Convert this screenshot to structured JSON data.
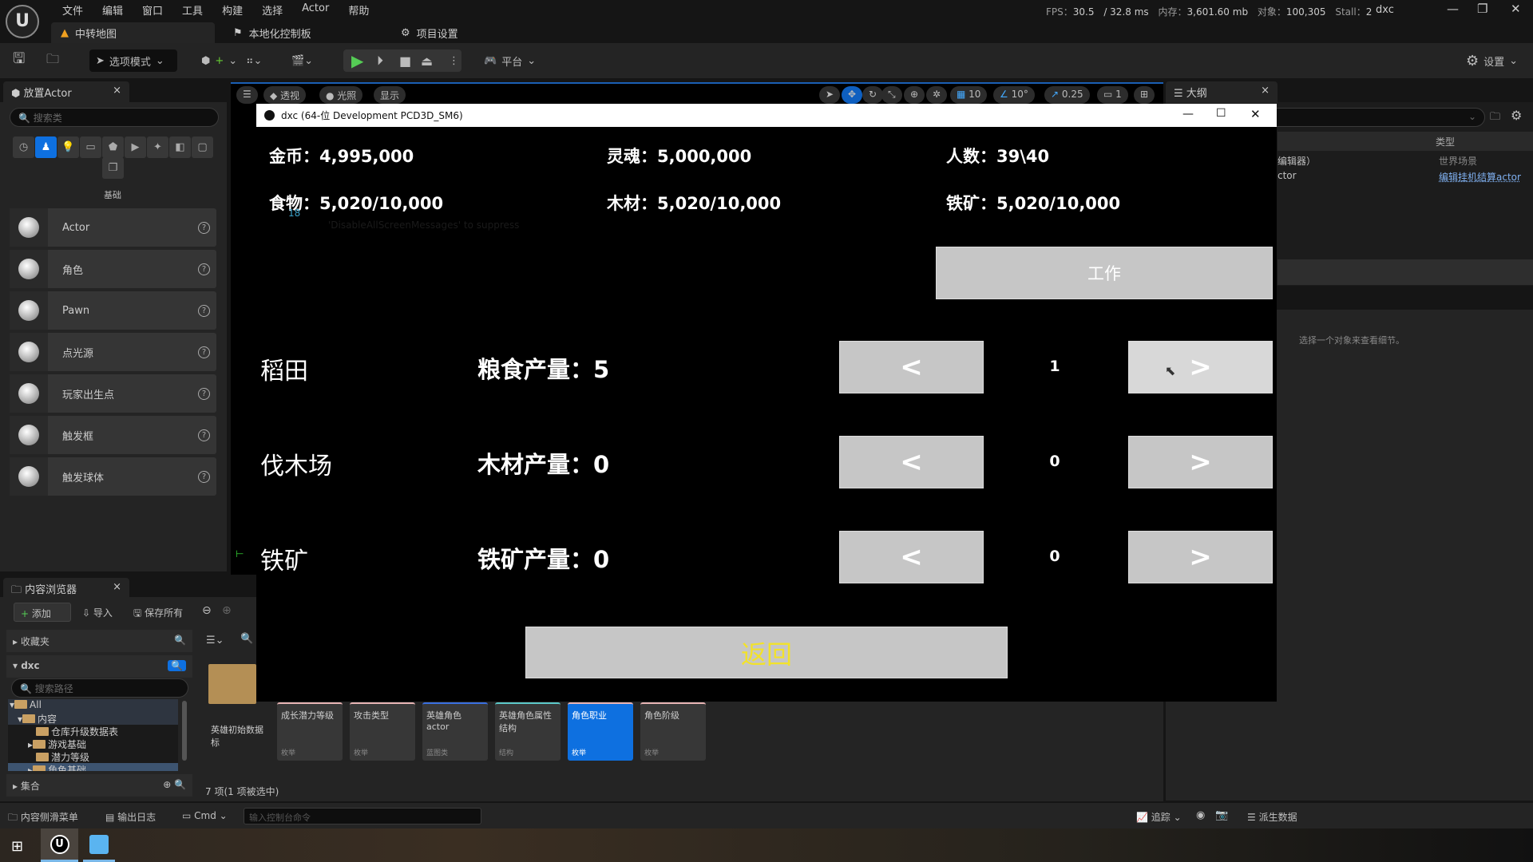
{
  "menu": [
    "文件",
    "编辑",
    "窗口",
    "工具",
    "构建",
    "选择",
    "Actor",
    "帮助"
  ],
  "perf": {
    "fps_label": "FPS：",
    "fps": "30.5",
    "ms": "/ 32.8 ms",
    "mem_label": "内存：",
    "mem": "3,601.60 mb",
    "obj_label": "对象：",
    "obj": "100,305",
    "stall_label": "Stall：",
    "stall": "2"
  },
  "project_name": "dxc",
  "tabs": [
    "中转地图",
    "本地化控制板",
    "项目设置"
  ],
  "toolbar": {
    "mode": "选项模式",
    "platform": "平台",
    "settings": "设置"
  },
  "place_actor": {
    "title": "放置Actor",
    "search_placeholder": "搜索类",
    "category": "基础",
    "items": [
      "Actor",
      "角色",
      "Pawn",
      "点光源",
      "玩家出生点",
      "触发框",
      "触发球体"
    ]
  },
  "viewport": {
    "perspective": "透视",
    "lighting": "光照",
    "show": "显示",
    "grid": "10",
    "angle": "10°",
    "scale": "0.25",
    "camera": "1"
  },
  "game_window": {
    "title": "dxc   (64-位 Development PCD3D_SM6)",
    "stats": [
      {
        "label": "金币：",
        "value": "4,995,000"
      },
      {
        "label": "灵魂：",
        "value": "5,000,000"
      },
      {
        "label": "人数：",
        "value": "39\\40"
      },
      {
        "label": "食物：",
        "value": "5,020/10,000"
      },
      {
        "label": "木材：",
        "value": "5,020/10,000"
      },
      {
        "label": "铁矿：",
        "value": "5,020/10,000"
      }
    ],
    "debug_number": "18",
    "debug_message": "'DisableAllScreenMessages' to suppress",
    "work_button": "工作",
    "rows": [
      {
        "name": "稻田",
        "production": "粮食产量：5",
        "count": "1"
      },
      {
        "name": "伐木场",
        "production": "木材产量：0",
        "count": "0"
      },
      {
        "name": "铁矿",
        "production": "铁矿产量：0",
        "count": "0"
      }
    ],
    "dec_label": "<",
    "inc_label": ">",
    "back_button": "返回",
    "back_color": "#f2e22a"
  },
  "outliner": {
    "title": "大纲",
    "type_header": "类型",
    "rows": [
      {
        "name": "编辑器）",
        "type": "世界场景"
      },
      {
        "name": "ctor",
        "type": "编辑挂机结算actor"
      }
    ],
    "details_hint": "选择一个对象来查看细节。"
  },
  "content_browser": {
    "title": "内容浏览器",
    "add": "添加",
    "import": "导入",
    "save_all": "保存所有",
    "favorites": "收藏夹",
    "root": "dxc",
    "path_placeholder": "搜索路径",
    "tree": [
      "All",
      "内容",
      "仓库升级数据表",
      "游戏基础",
      "潜力等级",
      "角色基础"
    ],
    "collections": "集合",
    "assets": [
      {
        "name": "英雄初始数据标",
        "type": ""
      },
      {
        "name": "成长潜力等级",
        "type": "枚举"
      },
      {
        "name": "攻击类型",
        "type": "枚举"
      },
      {
        "name": "英雄角色actor",
        "type": "蓝图类"
      },
      {
        "name": "英雄角色属性结构",
        "type": "结构"
      },
      {
        "name": "角色职业",
        "type": "枚举"
      },
      {
        "name": "角色阶级",
        "type": "枚举"
      }
    ],
    "count": "7 项(1 项被选中)"
  },
  "status_bar": {
    "drawer": "内容侧滑菜单",
    "log": "输出日志",
    "cmd": "Cmd",
    "cmd_placeholder": "输入控制台命令",
    "trace": "追踪",
    "derived": "派生数据"
  }
}
